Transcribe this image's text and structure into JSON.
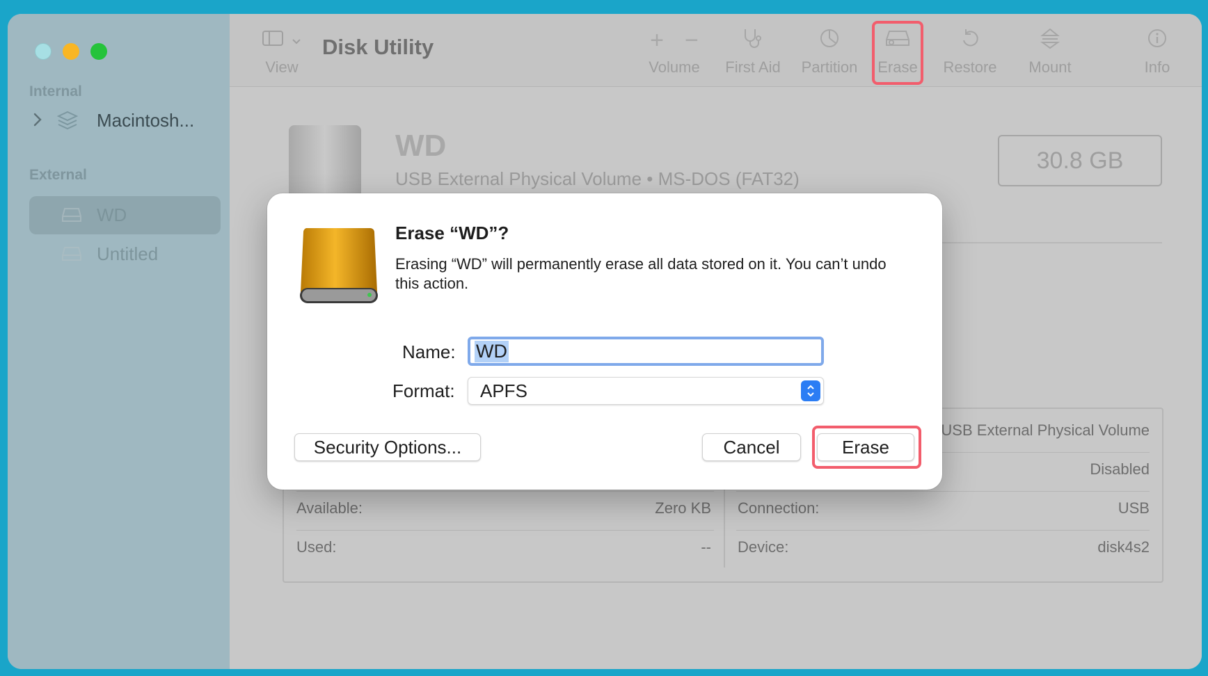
{
  "app": {
    "title": "Disk Utility"
  },
  "sidebar": {
    "sections": [
      {
        "label": "Internal",
        "items": [
          {
            "label": "Macintosh..."
          }
        ]
      },
      {
        "label": "External",
        "items": [
          {
            "label": "WD",
            "selected": true
          },
          {
            "label": "Untitled"
          }
        ]
      }
    ]
  },
  "toolbar": {
    "view": "View",
    "volume": "Volume",
    "first_aid": "First Aid",
    "partition": "Partition",
    "erase": "Erase",
    "restore": "Restore",
    "mount": "Mount",
    "info": "Info",
    "plus_icon": "+",
    "minus_icon": "−"
  },
  "volume": {
    "name": "WD",
    "subtitle": "USB External Physical Volume • MS-DOS (FAT32)",
    "size": "30.8 GB"
  },
  "details": {
    "available_label": "Available:",
    "available_value": "Zero KB",
    "used_label": "Used:",
    "used_value": "--",
    "type_value": "USB External Physical Volume",
    "owners_value": "Disabled",
    "connection_label": "Connection:",
    "connection_value": "USB",
    "device_label": "Device:",
    "device_value": "disk4s2"
  },
  "dialog": {
    "title": "Erase “WD”?",
    "message": "Erasing “WD” will permanently erase all data stored on it. You can’t undo this action.",
    "name_label": "Name:",
    "name_value": "WD",
    "format_label": "Format:",
    "format_value": "APFS",
    "security_button": "Security Options...",
    "cancel_button": "Cancel",
    "erase_button": "Erase"
  },
  "colors": {
    "highlight": "#f25d6c",
    "accent": "#2b7df4",
    "traffic_close": "#a7dfe4",
    "traffic_minimize": "#f9b624",
    "traffic_maximize": "#25c33b"
  },
  "icons": [
    "sidebar-toggle-icon",
    "chevron-down-icon",
    "plus-icon",
    "minus-icon",
    "stethoscope-icon",
    "pie-chart-icon",
    "erase-drive-icon",
    "restore-arrow-icon",
    "mount-icon",
    "info-icon",
    "layers-icon",
    "drive-icon",
    "external-drive-icon"
  ]
}
